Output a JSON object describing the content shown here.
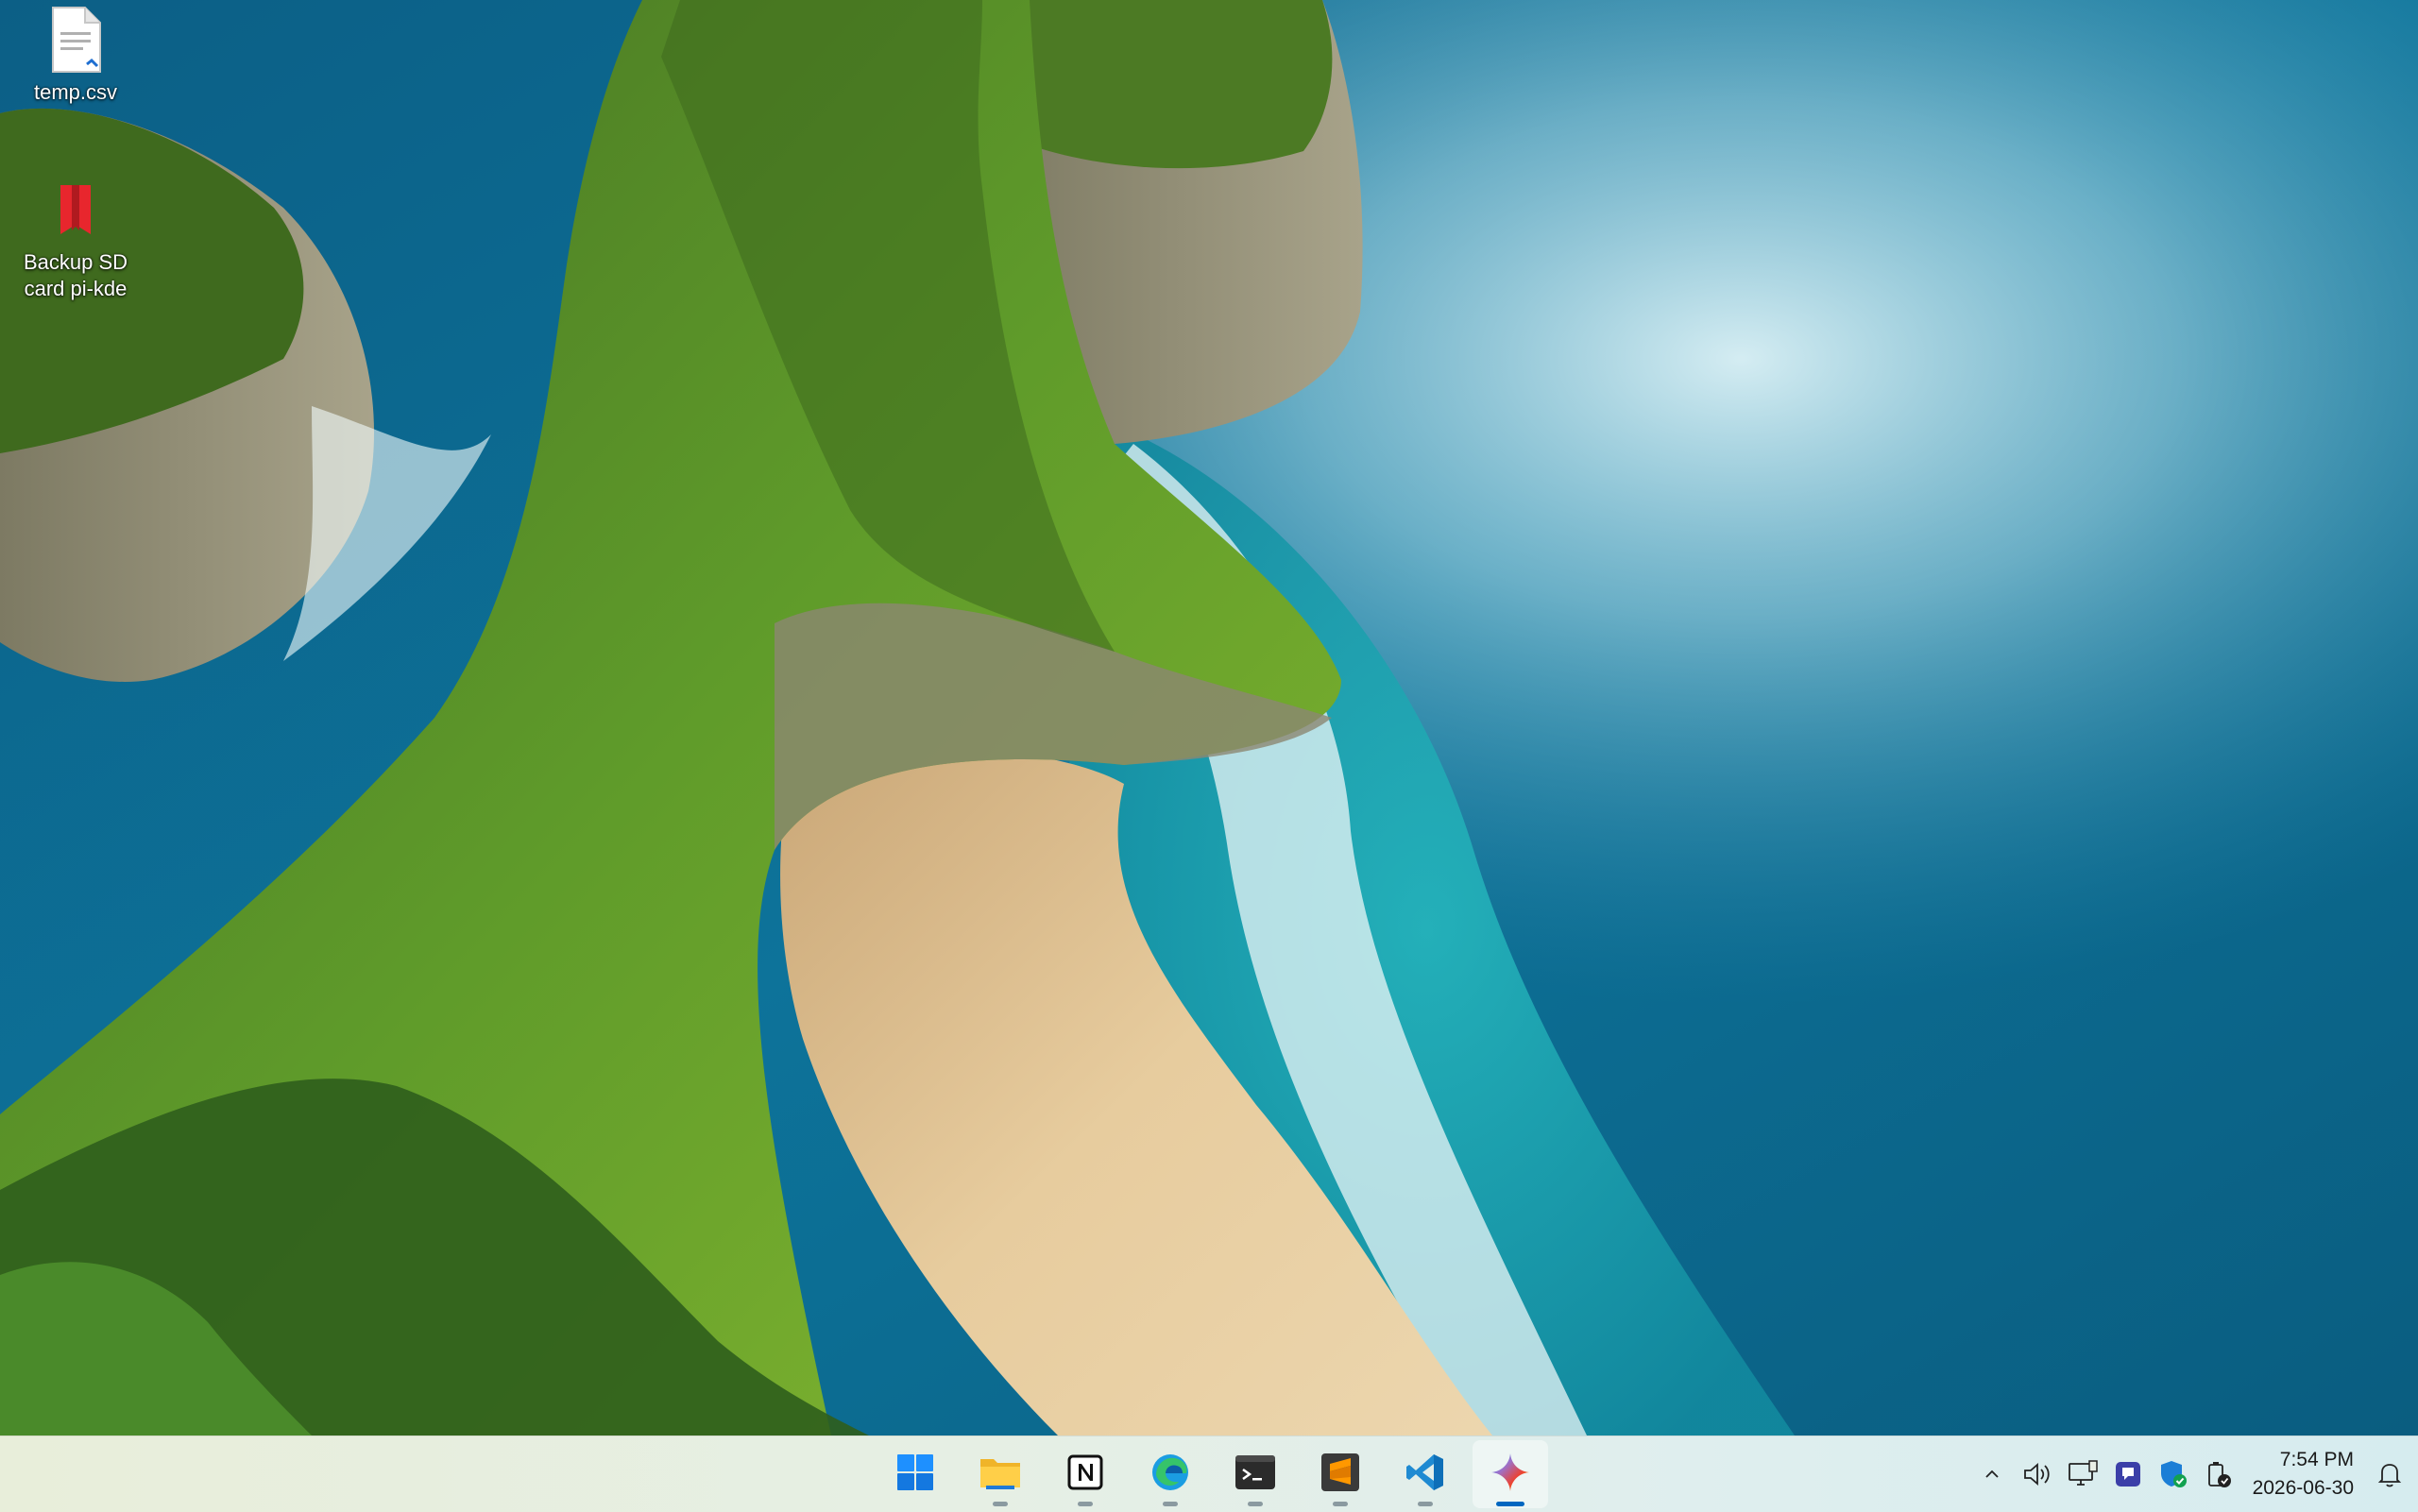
{
  "desktop": {
    "icons": [
      {
        "label": "temp.csv",
        "icon": "csv-file-icon"
      },
      {
        "label": "Backup SD card pi-kde",
        "icon": "red-bookmark-icon"
      }
    ]
  },
  "taskbar": {
    "apps": [
      {
        "name": "Start",
        "icon": "windows-start-icon",
        "running": false,
        "active": false
      },
      {
        "name": "File Explorer",
        "icon": "folder-icon",
        "running": true,
        "active": false
      },
      {
        "name": "Notion",
        "icon": "notion-icon",
        "running": true,
        "active": false
      },
      {
        "name": "Microsoft Edge",
        "icon": "edge-icon",
        "running": true,
        "active": false
      },
      {
        "name": "Terminal",
        "icon": "terminal-icon",
        "running": true,
        "active": false
      },
      {
        "name": "Sublime Text",
        "icon": "sublime-icon",
        "running": true,
        "active": false
      },
      {
        "name": "Visual Studio Code",
        "icon": "vscode-icon",
        "running": true,
        "active": false
      },
      {
        "name": "Gemini",
        "icon": "sparkle-icon",
        "running": true,
        "active": true
      }
    ],
    "tray": {
      "icons": [
        "chevron-up-icon",
        "volume-icon",
        "network-display-icon",
        "app-tray-icon",
        "defender-shield-icon",
        "battery-saver-icon"
      ],
      "time": "7:54 PM",
      "date": "2026-06-30",
      "notification_icon": "bell-icon"
    }
  },
  "colors": {
    "accent": "#0067c0",
    "taskbar_bg": "#e4efe4",
    "sea": "#0e6e95",
    "lagoon": "#1fa7b0",
    "cliff_green": "#5e9a2a",
    "sand": "#e6c999"
  }
}
